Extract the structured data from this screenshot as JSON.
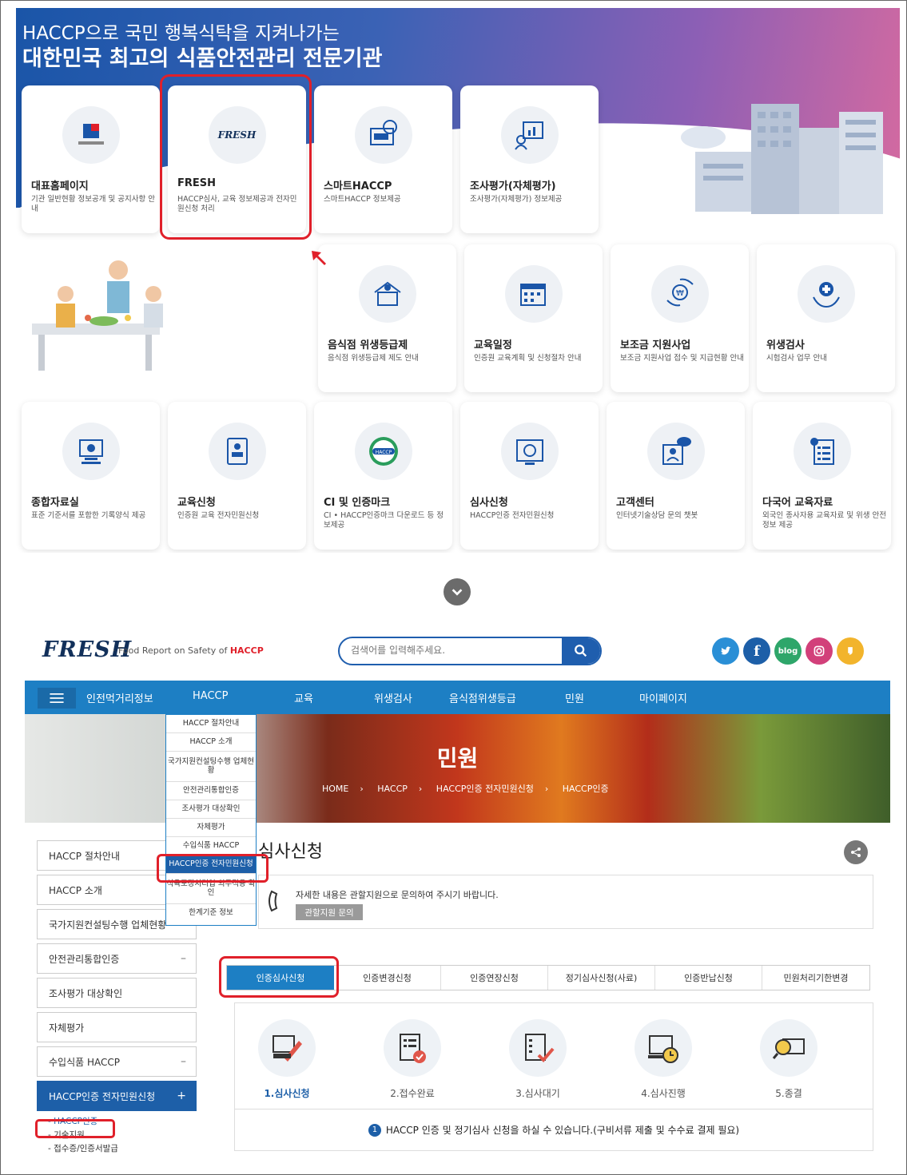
{
  "portal": {
    "title1": "HACCP으로 국민 행복식탁을 지켜나가는",
    "title2": "대한민국 최고의 식품안전관리 전문기관",
    "cards": [
      {
        "title": "대표홈페이지",
        "desc": "기관 일반현황 정보공개 및 공지사항 안내",
        "icon": "org-logo-icon"
      },
      {
        "title": "FRESH",
        "desc": "HACCP심사, 교육 정보제공과 전자민원신청 처리",
        "icon": "fresh-logo-icon",
        "logo_text": "FRESH"
      },
      {
        "title": "스마트HACCP",
        "desc": "스마트HACCP 정보제공",
        "icon": "smart-haccp-icon"
      },
      {
        "title": "조사평가(자체평가)",
        "desc": "조사평가(자체평가) 정보제공",
        "icon": "evaluation-icon"
      },
      {
        "title": "음식점 위생등급제",
        "desc": "음식점 위생등급제 제도 안내",
        "icon": "restaurant-icon"
      },
      {
        "title": "교육일정",
        "desc": "인증원 교육계획 및 신청절차 안내",
        "icon": "calendar-icon"
      },
      {
        "title": "보조금 지원사업",
        "desc": "보조금 지원사업 접수 및 지급현황 안내",
        "icon": "subsidy-icon"
      },
      {
        "title": "위생검사",
        "desc": "시험검사 업무 안내",
        "icon": "hygiene-icon"
      },
      {
        "title": "종합자료실",
        "desc": "표준 기준서를 포함한 기록양식 제공",
        "icon": "archive-icon"
      },
      {
        "title": "교육신청",
        "desc": "인증원 교육 전자민원신청",
        "icon": "education-icon"
      },
      {
        "title": "CI 및 인증마크",
        "desc": "CI • HACCP인증마크 다운로드 등 정보제공",
        "icon": "haccp-mark-icon"
      },
      {
        "title": "심사신청",
        "desc": "HACCP인증 전자민원신청",
        "icon": "audit-icon"
      },
      {
        "title": "고객센터",
        "desc": "인터넷기술상담 문의 챗봇",
        "icon": "chat-icon"
      },
      {
        "title": "다국어 교육자료",
        "desc": "외국인 종사자용 교육자료 및 위생 안전 정보 제공",
        "icon": "multilang-icon"
      }
    ]
  },
  "site": {
    "logo": "FRESH",
    "logo_sub_prefix": "Food Report on Safety of",
    "logo_sub_highlight": "HACCP",
    "search_placeholder": "검색어를 입력해주세요.",
    "social": [
      "twitter-icon",
      "facebook-icon",
      "blog",
      "instagram-icon",
      "kakao-icon"
    ],
    "social_blog_label": "blog",
    "nav": [
      "인전먹거리정보",
      "HACCP",
      "교육",
      "위생검사",
      "음식점위생등급",
      "민원",
      "마이페이지"
    ],
    "banner_title": "민원",
    "breadcrumb": [
      "HOME",
      "HACCP",
      "HACCP인증 전자민원신청",
      "HACCP인증"
    ],
    "dropdown": [
      "HACCP 절차안내",
      "HACCP 소개",
      "국가지원컨설팅수행 업체현황",
      "안전관리통합인증",
      "조사평가 대상확인",
      "자체평가",
      "수입식품 HACCP",
      "HACCP인증 전자민원신청",
      "식육포장처리업 의무적용 확인",
      "한계기준 정보"
    ],
    "sidebar": [
      "HACCP 절차안내",
      "HACCP 소개",
      "국가지원컨설팅수행 업체현황",
      "안전관리통합인증",
      "조사평가 대상확인",
      "자체평가",
      "수입식품 HACCP",
      "HACCP인증 전자민원신청"
    ],
    "sidebar_sub": [
      "- HACCP인증",
      "- 기술지원",
      "- 접수증/인증서발급"
    ],
    "page_title": "심사신청",
    "info_text": "자세한 내용은 관할지원으로 문의하여 주시기 바랍니다.",
    "info_button": "관할지원 문의",
    "tabs": [
      "인증심사신청",
      "인증변경신청",
      "인증연장신청",
      "정기심사신청(사료)",
      "인증반납신청",
      "민원처리기한변경"
    ],
    "steps": [
      "1.심사신청",
      "2.접수완료",
      "3.심사대기",
      "4.심사진행",
      "5.종결"
    ],
    "note_num": "1",
    "note": "HACCP 인증 및 정기심사 신청을 하실 수 있습니다.(구비서류 제출 및 수수료 결제 필요)"
  },
  "colors": {
    "primary": "#1d7fc4",
    "dark": "#1d5fa8",
    "highlight": "#e0202a"
  }
}
